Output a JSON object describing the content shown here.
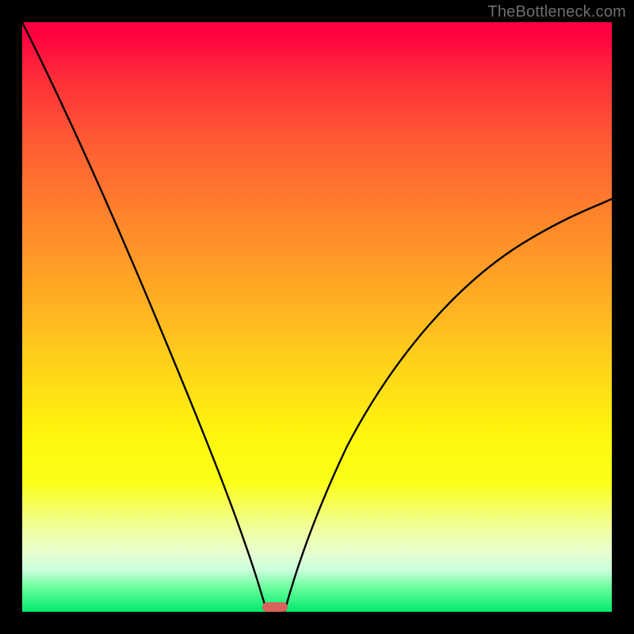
{
  "watermark": {
    "text": "TheBottleneck.com"
  },
  "chart_data": {
    "type": "line",
    "title": "",
    "xlabel": "",
    "ylabel": "",
    "xlim": [
      0,
      100
    ],
    "ylim": [
      0,
      100
    ],
    "gradient_stops": [
      {
        "pct": 0,
        "color": "#ff0040"
      },
      {
        "pct": 2,
        "color": "#ff0040"
      },
      {
        "pct": 9,
        "color": "#ff2b3a"
      },
      {
        "pct": 20,
        "color": "#ff5a33"
      },
      {
        "pct": 32,
        "color": "#ff812c"
      },
      {
        "pct": 45,
        "color": "#ffa824"
      },
      {
        "pct": 58,
        "color": "#ffd21a"
      },
      {
        "pct": 70,
        "color": "#fff60e"
      },
      {
        "pct": 78,
        "color": "#fbff18"
      },
      {
        "pct": 86,
        "color": "#f1ffa0"
      },
      {
        "pct": 90,
        "color": "#e6ffd0"
      },
      {
        "pct": 93,
        "color": "#c9ffdc"
      },
      {
        "pct": 96,
        "color": "#66ff99"
      },
      {
        "pct": 100,
        "color": "#00e96e"
      }
    ],
    "series": [
      {
        "name": "bottleneck-curve-left",
        "x": [
          0,
          5,
          10,
          15,
          20,
          25,
          30,
          34,
          38,
          40,
          41.5
        ],
        "y": [
          100,
          93,
          85,
          76,
          66,
          55,
          42,
          29,
          14,
          5,
          0
        ]
      },
      {
        "name": "bottleneck-curve-right",
        "x": [
          44.5,
          48,
          55,
          62,
          70,
          78,
          86,
          93,
          100
        ],
        "y": [
          0,
          12,
          28,
          40,
          49,
          56,
          62,
          66,
          70
        ]
      }
    ],
    "marker": {
      "name": "optimal-zone",
      "x_center": 43,
      "width": 4,
      "y": 0,
      "color": "#d9625b"
    }
  }
}
